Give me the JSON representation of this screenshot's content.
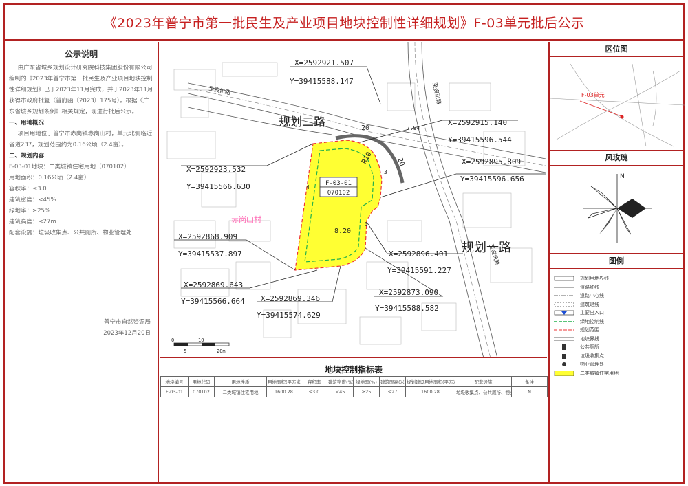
{
  "title": "《2023年普宁市第一批民生及产业项目地块控制性详细规划》F-03单元批后公示",
  "notice": {
    "heading": "公示说明",
    "intro": "由广东省城乡规划设计研究院科技集团股份有限公司编制的《2023年普宁市第一批民生及产业项目地块控制性详细规划》已于2023年11月完成，并于2023年11月获得市政府批复（普府函〔2023〕175号）。根据《广东省城乡规划条例》相关规定，现进行批后公示。",
    "sec1_title": "一、用地概况",
    "sec1_body": "项目用地位于普宁市赤岗镇赤岗山村，单元北侧临近省道237，规划范围约为0.16公顷（2.4亩）。",
    "sec2_title": "二、规划内容",
    "rows": [
      "F-03-01地块：二类城镇住宅用地（070102）",
      "用地面积：0.16公顷（2.4亩）",
      "容积率：≤3.0",
      "建筑密度：<45%",
      "绿地率：≥25%",
      "建筑高度：≤27m",
      "配套设施：垃圾收集点、公共厕所、物业管理处"
    ],
    "signer": "普宁市自然资源局",
    "date": "2023年12月20日"
  },
  "map": {
    "road_north": "规划二路",
    "road_east": "规划一路",
    "road_s_nw": "至资讯路",
    "road_s_ne": "至资讯路",
    "road_s_se": "至资讯路",
    "village": "赤岗山村",
    "parcel_id": "F-03-01",
    "parcel_code": "070102",
    "building_height": "8.20",
    "scale_labels": [
      "0",
      "10",
      "5",
      "20m"
    ],
    "widths": [
      "20",
      "R10",
      "20",
      "7.94",
      "4",
      "3",
      "3"
    ],
    "coords": [
      {
        "x": "X=2592921.507",
        "y": "Y=39415588.147"
      },
      {
        "x": "X=2592915.140",
        "y": "Y=39415596.544"
      },
      {
        "x": "X=2592923.532",
        "y": "Y=39415566.630"
      },
      {
        "x": "X=2592895.809",
        "y": "Y=39415596.656"
      },
      {
        "x": "X=2592868.909",
        "y": "Y=39415537.897"
      },
      {
        "x": "X=2592896.401",
        "y": "Y=39415591.227"
      },
      {
        "x": "X=2592869.643",
        "y": "Y=39415566.664"
      },
      {
        "x": "X=2592869.346",
        "y": "Y=39415574.629"
      },
      {
        "x": "X=2592873.090",
        "y": "Y=39415588.582"
      }
    ]
  },
  "table": {
    "title": "地块控制指标表",
    "headers": [
      "地块编号",
      "用地代码",
      "用地性质",
      "用地面积(平方米)",
      "容积率",
      "建筑密度(%)",
      "绿地率(%)",
      "建筑限高(米)",
      "规划建设用地面积(平方米)",
      "配套设施",
      "备注"
    ],
    "row": [
      "F-03-01",
      "070102",
      "二类城镇住宅用地",
      "1600.28",
      "≤3.0",
      "<45",
      "≥25",
      "≤27",
      "1600.28",
      "垃圾收集点、公共厕所、物业管理处",
      "N"
    ]
  },
  "right": {
    "location_title": "区位图",
    "location_label": "F-03单元",
    "rose_title": "风玫瑰",
    "rose_north": "N",
    "legend_title": "图例",
    "legend": [
      "规划用地界线",
      "道路红线",
      "道路中心线",
      "建筑退线",
      "主要出入口",
      "绿地控制线",
      "规划范围",
      "地块界线",
      "公共厕所",
      "垃圾收集点",
      "物业管理处",
      "二类城镇住宅用地"
    ]
  },
  "colors": {
    "frame": "#b22222",
    "title": "#c62020",
    "parcel": "#ffff33",
    "green_line": "#22b14c"
  }
}
